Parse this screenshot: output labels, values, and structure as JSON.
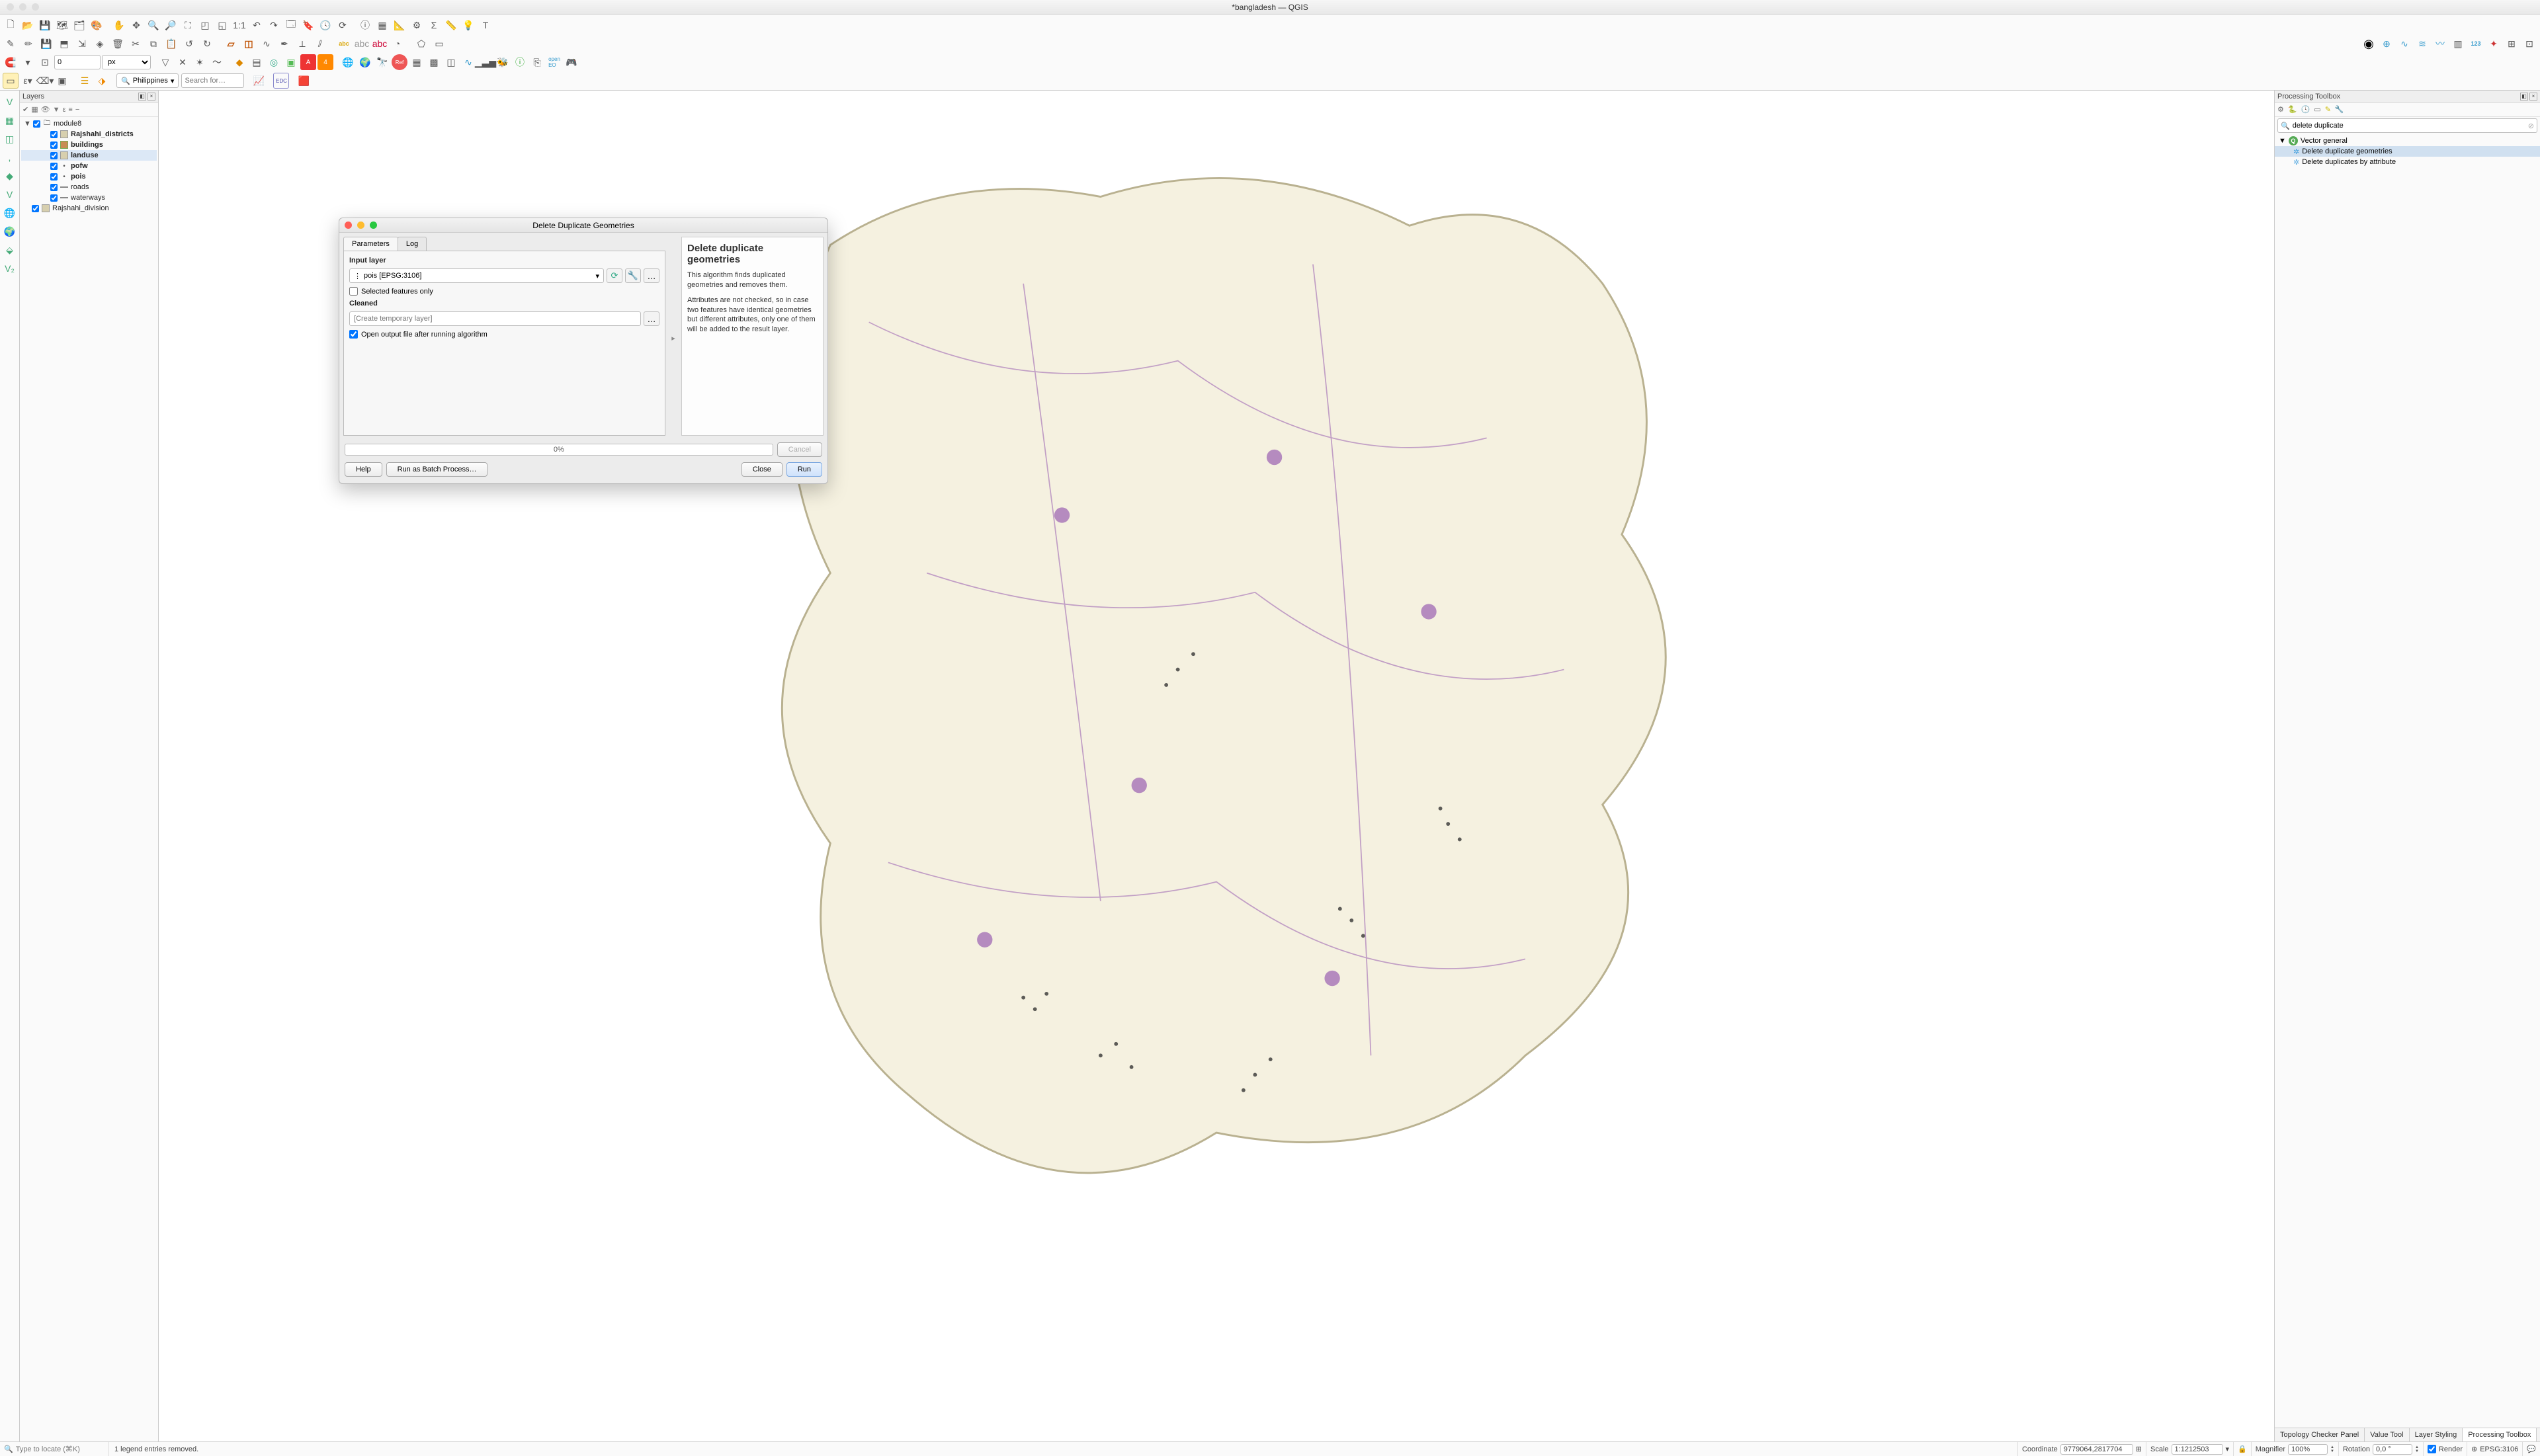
{
  "window_title": "*bangladesh — QGIS",
  "toolbars": {
    "snap_value": "0",
    "snap_unit": "px",
    "country": "Philippines",
    "search_placeholder": "Search for…"
  },
  "layers_panel": {
    "title": "Layers",
    "group": "module8",
    "items": [
      {
        "name": "Rajshahi_districts",
        "bold": true,
        "icon": "poly2"
      },
      {
        "name": "buildings",
        "bold": true,
        "icon": "poly"
      },
      {
        "name": "landuse",
        "bold": true,
        "icon": "poly2",
        "selected": true
      },
      {
        "name": "pofw",
        "bold": true,
        "icon": "point"
      },
      {
        "name": "pois",
        "bold": true,
        "icon": "point"
      },
      {
        "name": "roads",
        "bold": false,
        "icon": "line"
      },
      {
        "name": "waterways",
        "bold": false,
        "icon": "line"
      }
    ],
    "extra": "Rajshahi_division"
  },
  "processing": {
    "title": "Processing Toolbox",
    "search_value": "delete duplicate",
    "group": "Vector general",
    "algos": [
      "Delete duplicate geometries",
      "Delete duplicates by attribute"
    ]
  },
  "right_tabs": [
    "Topology Checker Panel",
    "Value Tool",
    "Layer Styling",
    "Processing Toolbox"
  ],
  "dialog": {
    "title": "Delete Duplicate Geometries",
    "tabs": [
      "Parameters",
      "Log"
    ],
    "input_label": "Input layer",
    "input_value": "pois [EPSG:3106]",
    "selected_only": "Selected features only",
    "cleaned_label": "Cleaned",
    "cleaned_placeholder": "[Create temporary layer]",
    "open_after": "Open output file after running algorithm",
    "help_title": "Delete duplicate geometries",
    "help_p1": "This algorithm finds duplicated geometries and removes them.",
    "help_p2": "Attributes are not checked, so in case two features have identical geometries but different attributes, only one of them will be added to the result layer.",
    "progress": "0%",
    "btn_help": "Help",
    "btn_batch": "Run as Batch Process…",
    "btn_cancel": "Cancel",
    "btn_close": "Close",
    "btn_run": "Run"
  },
  "status": {
    "locator_placeholder": "Type to locate (⌘K)",
    "message": "1 legend entries removed.",
    "coord_label": "Coordinate",
    "coord_value": "9779064,2817704",
    "scale_label": "Scale",
    "scale_value": "1:1212503",
    "mag_label": "Magnifier",
    "mag_value": "100%",
    "rot_label": "Rotation",
    "rot_value": "0,0 °",
    "render": "Render",
    "crs": "EPSG:3106"
  }
}
